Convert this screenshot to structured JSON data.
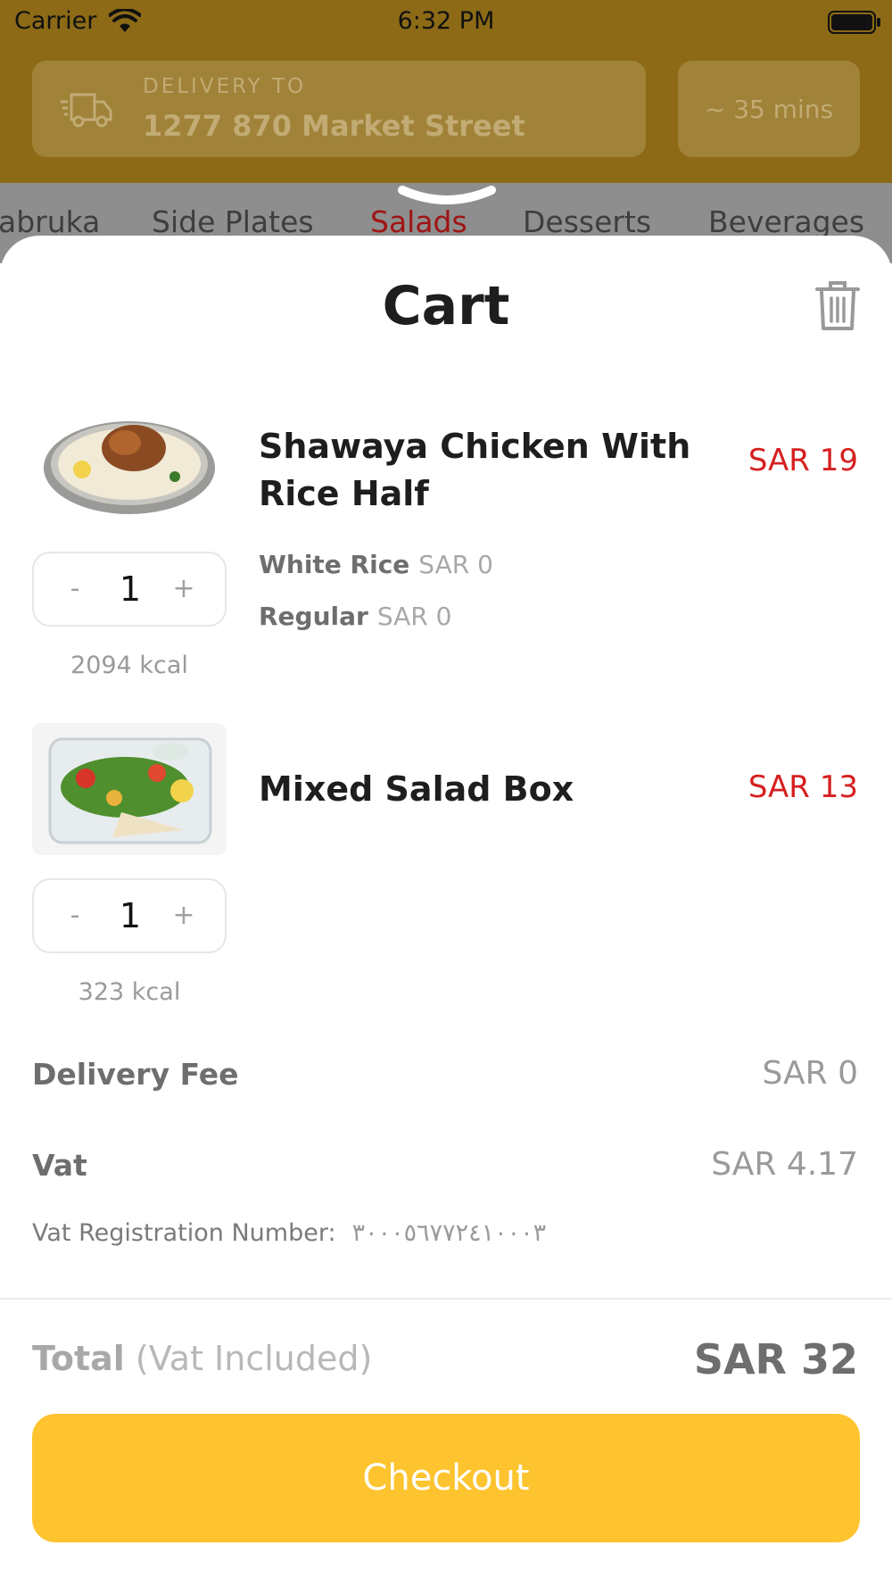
{
  "status_bar": {
    "carrier": "Carrier",
    "time": "6:32 PM"
  },
  "header": {
    "delivery_caption": "DELIVERY TO",
    "delivery_address": "1277 870 Market Street",
    "eta": "~ 35 mins"
  },
  "categories": [
    {
      "label": "abruka",
      "active": false
    },
    {
      "label": "Side Plates",
      "active": false
    },
    {
      "label": "Salads",
      "active": true
    },
    {
      "label": "Desserts",
      "active": false
    },
    {
      "label": "Beverages",
      "active": false
    }
  ],
  "cart": {
    "title": "Cart",
    "items": [
      {
        "name": "Shawaya Chicken With Rice Half",
        "price": "SAR 19",
        "quantity": "1",
        "kcal": "2094 kcal",
        "minus": "-",
        "plus": "+",
        "options": [
          {
            "name": "White Rice",
            "price": "SAR 0"
          },
          {
            "name": "Regular",
            "price": "SAR 0"
          }
        ]
      },
      {
        "name": "Mixed Salad Box",
        "price": "SAR 13",
        "quantity": "1",
        "kcal": "323 kcal",
        "minus": "-",
        "plus": "+"
      }
    ],
    "delivery_fee_label": "Delivery Fee",
    "delivery_fee_value": "SAR 0",
    "vat_label": "Vat",
    "vat_value": "SAR 4.17",
    "vat_registration_label": "Vat Registration Number:",
    "vat_registration_number": "٣٠٠٠٥٦٧٧٢٤١٠٠٠٣",
    "total_label": "Total",
    "total_note": "(Vat Included)",
    "total_value": "SAR 32",
    "checkout_label": "Checkout"
  },
  "colors": {
    "accent": "#fec42f",
    "price": "#d62020",
    "active_category": "#a01414"
  }
}
